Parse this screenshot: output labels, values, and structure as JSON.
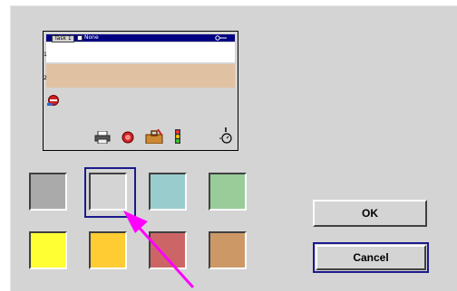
{
  "preview": {
    "tab_label": "Task 1",
    "mode_label": "None",
    "line_numbers": [
      "1",
      "2"
    ],
    "tools": [
      "printer-icon",
      "stop-icon",
      "toolbox-icon",
      "traffic-light-icon",
      "timer-icon"
    ]
  },
  "swatches": [
    {
      "name": "gray",
      "color": "#aaaaaa"
    },
    {
      "name": "light-gray",
      "color": "#d4d4d4",
      "selected": true
    },
    {
      "name": "light-teal",
      "color": "#99cccc"
    },
    {
      "name": "light-green",
      "color": "#99cc99"
    },
    {
      "name": "yellow",
      "color": "#ffff33"
    },
    {
      "name": "orange",
      "color": "#ffcc33"
    },
    {
      "name": "rose",
      "color": "#cc6666"
    },
    {
      "name": "tan",
      "color": "#cc9966"
    }
  ],
  "buttons": {
    "ok_label": "OK",
    "cancel_label": "Cancel"
  },
  "colors": {
    "dialog_bg": "#d4d4d4",
    "title_bar": "#000080",
    "selection_border": "#1a1a8c",
    "callout_arrow": "#ff00ff"
  }
}
